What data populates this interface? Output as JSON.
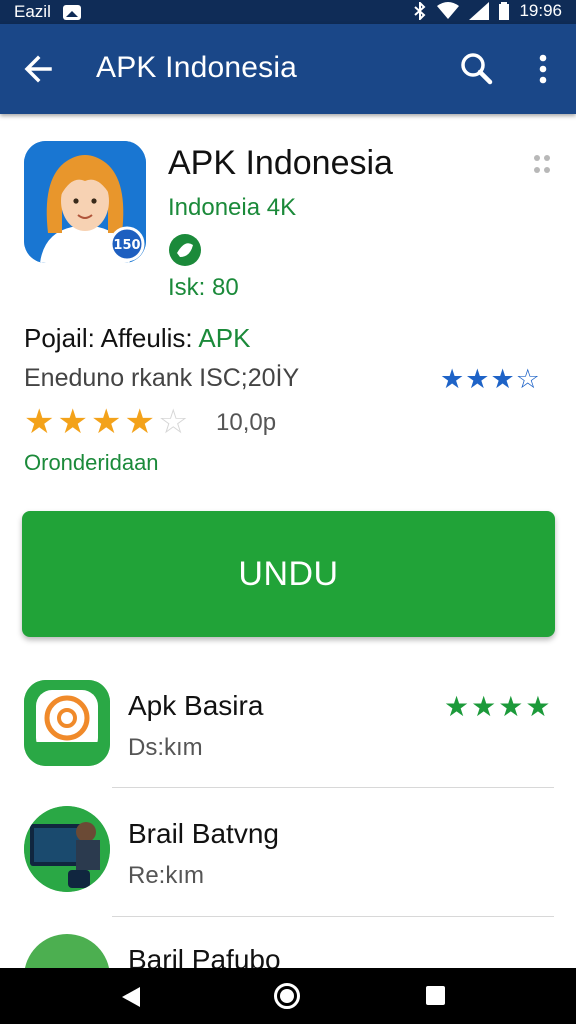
{
  "status_bar": {
    "carrier": "Eazil",
    "time": "19:96"
  },
  "app_bar": {
    "title": "APK Indonesia",
    "icons": [
      "arrow-back-icon",
      "search-icon",
      "more-vert-icon"
    ]
  },
  "app": {
    "name": "APK Indonesia",
    "developer": "Indoneia 4K",
    "size": "Isk: 80",
    "icon_badge": "150"
  },
  "details": {
    "title_prefix": "Pojail: Affeulis: ",
    "title_accent": "APK",
    "subtitle": "Eneduno rkank ISC;20İY",
    "rating_blue": 3,
    "rating_blue_max": 4,
    "rating_orange": 4,
    "rating_orange_max": 5,
    "rating_count": "10,0p",
    "category": "Oronderidaan"
  },
  "install_button": {
    "label": "UNDU"
  },
  "related": [
    {
      "name": "Apk Basira",
      "sub": "Ds:kım",
      "stars": 4
    },
    {
      "name": "Brail Batvng",
      "sub": "Re:kım",
      "stars": 0
    },
    {
      "name": "Baril Pafubo",
      "sub": "",
      "stars": 0
    }
  ],
  "colors": {
    "app_bar": "#1a4788",
    "status_bar": "#0f2c57",
    "accent_green": "#21a338",
    "text_green": "#1b8a3a",
    "star_orange": "#f3a21a",
    "star_blue": "#1e63c7"
  }
}
